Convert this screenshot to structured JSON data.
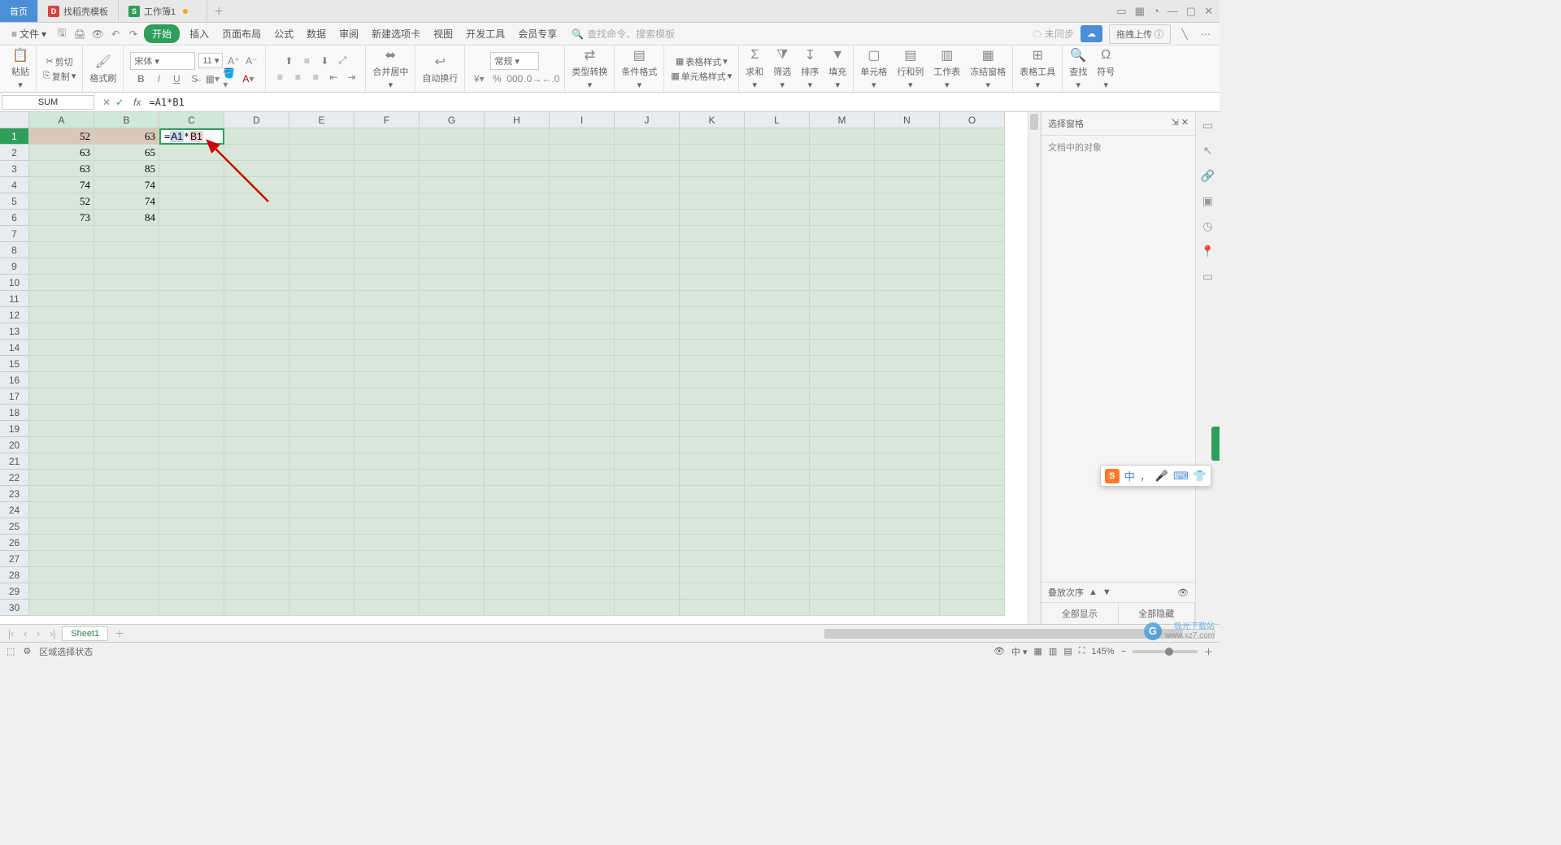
{
  "tabs": {
    "home": "首页",
    "t1": "找稻壳模板",
    "t2": "工作簿1"
  },
  "menubar": {
    "file": "文件",
    "start": "开始",
    "items": [
      "插入",
      "页面布局",
      "公式",
      "数据",
      "审阅",
      "新建选项卡",
      "视图",
      "开发工具",
      "会员专享"
    ],
    "search_ph": "查找命令、搜索模板",
    "unsync": "未同步",
    "upload": "拖拽上传"
  },
  "ribbon": {
    "paste": "粘贴",
    "cut": "剪切",
    "copy": "复制",
    "brush": "格式刷",
    "font_name": "宋体",
    "font_size": "11",
    "merge": "合并居中",
    "wrap": "自动换行",
    "number_fmt": "常规",
    "type_conv": "类型转换",
    "cond_fmt": "条件格式",
    "table_style": "表格样式",
    "cell_style": "单元格样式",
    "sum": "求和",
    "filter": "筛选",
    "sort": "排序",
    "fill": "填充",
    "cell": "单元格",
    "rowcol": "行和列",
    "sheet": "工作表",
    "freeze": "冻结窗格",
    "table_tool": "表格工具",
    "find": "查找",
    "symbol": "符号"
  },
  "formula": {
    "name": "SUM",
    "text": "=A1*B1",
    "cell_display": "= A1 * B1"
  },
  "columns": [
    "A",
    "B",
    "C",
    "D",
    "E",
    "F",
    "G",
    "H",
    "I",
    "J",
    "K",
    "L",
    "M",
    "N",
    "O"
  ],
  "data": {
    "A": [
      52,
      63,
      63,
      74,
      52,
      73
    ],
    "B": [
      63,
      65,
      85,
      74,
      74,
      84
    ]
  },
  "rightpanel": {
    "title": "选择窗格",
    "sub": "文档中的对象",
    "stack": "叠放次序",
    "show_all": "全部显示",
    "hide_all": "全部隐藏"
  },
  "sheet_tab": "Sheet1",
  "status": {
    "text": "区域选择状态",
    "zoom": "145%"
  },
  "watermark": {
    "l1": "极光下载站",
    "l2": "www.xz7.com"
  }
}
